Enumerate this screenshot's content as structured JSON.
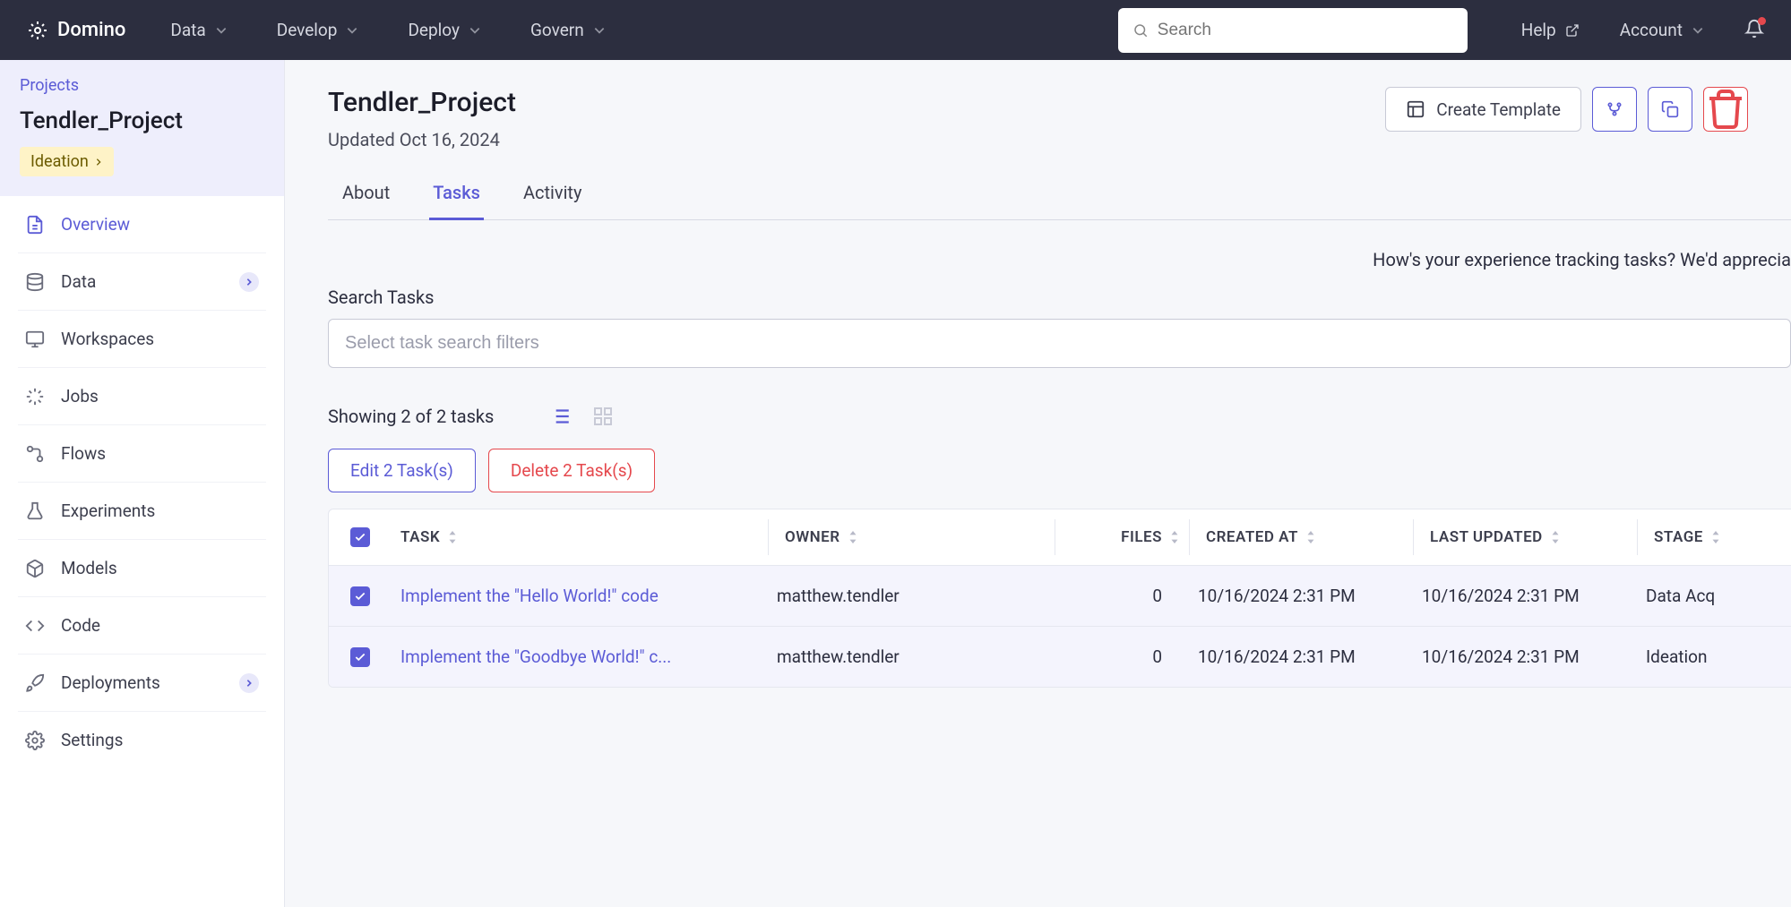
{
  "nav": {
    "brand": "Domino",
    "items": [
      "Data",
      "Develop",
      "Deploy",
      "Govern"
    ],
    "search_placeholder": "Search",
    "help": "Help",
    "account": "Account"
  },
  "sidebar": {
    "breadcrumb": "Projects",
    "title": "Tendler_Project",
    "tag": "Ideation",
    "items": [
      {
        "label": "Overview",
        "icon": "file",
        "active": true
      },
      {
        "label": "Data",
        "icon": "database",
        "badge": true
      },
      {
        "label": "Workspaces",
        "icon": "monitor"
      },
      {
        "label": "Jobs",
        "icon": "spinner"
      },
      {
        "label": "Flows",
        "icon": "flow"
      },
      {
        "label": "Experiments",
        "icon": "flask"
      },
      {
        "label": "Models",
        "icon": "cube"
      },
      {
        "label": "Code",
        "icon": "code"
      },
      {
        "label": "Deployments",
        "icon": "rocket",
        "badge": true
      },
      {
        "label": "Settings",
        "icon": "gear"
      }
    ]
  },
  "main": {
    "title": "Tendler_Project",
    "subtitle": "Updated Oct 16, 2024",
    "create_template": "Create Template",
    "tabs": [
      "About",
      "Tasks",
      "Activity"
    ],
    "active_tab": "Tasks",
    "feedback": "How's your experience tracking tasks? We'd apprecia",
    "search_label": "Search Tasks",
    "search_placeholder": "Select task search filters",
    "showing": "Showing 2 of 2 tasks",
    "edit_btn": "Edit 2 Task(s)",
    "delete_btn": "Delete 2 Task(s)",
    "columns": [
      "TASK",
      "OWNER",
      "FILES",
      "CREATED AT",
      "LAST UPDATED",
      "STAGE"
    ],
    "rows": [
      {
        "task": "Implement the \"Hello World!\" code",
        "owner": "matthew.tendler",
        "files": "0",
        "created": "10/16/2024 2:31 PM",
        "updated": "10/16/2024 2:31 PM",
        "stage": "Data Acq"
      },
      {
        "task": "Implement the \"Goodbye World!\" c...",
        "owner": "matthew.tendler",
        "files": "0",
        "created": "10/16/2024 2:31 PM",
        "updated": "10/16/2024 2:31 PM",
        "stage": "Ideation"
      }
    ]
  }
}
